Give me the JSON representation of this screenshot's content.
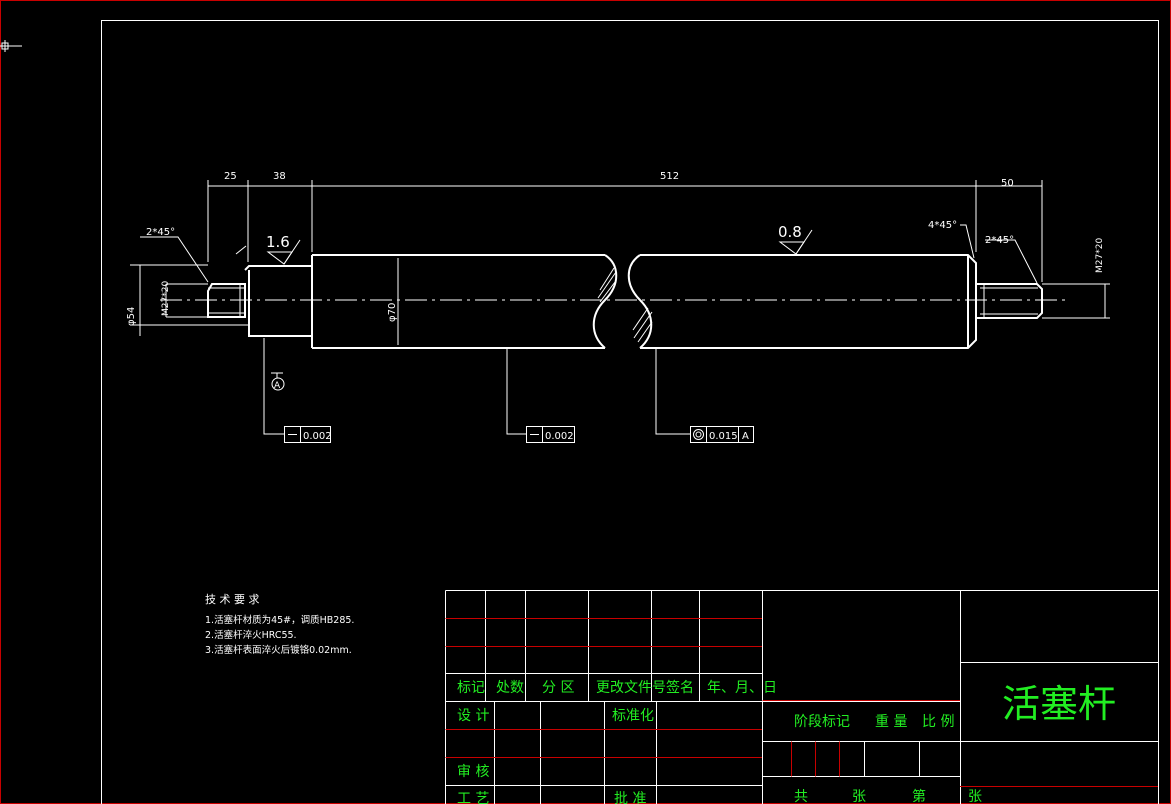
{
  "dimensions": {
    "d25": "25",
    "d38": "38",
    "d512": "512",
    "d50": "50",
    "chamfer_left": "2*45°",
    "chamfer_right_inner": "4*45°",
    "chamfer_right": "2*45°",
    "dia_left": "φ54",
    "thread_left": "M27*20",
    "dia_main": "φ70",
    "thread_right": "M27*20",
    "rough_left": "1.6",
    "rough_right": "0.8",
    "datum": "A",
    "tol_flat_1": "0.002",
    "tol_flat_2": "0.002",
    "tol_coax": "0.015",
    "tol_coax_datum": "A"
  },
  "tech_requirements": {
    "heading": "技 术 要 求",
    "items": [
      "1.活塞杆材质为45#，调质HB285.",
      "2.活塞杆淬火HRC55.",
      "3.活塞杆表面淬火后镀铬0.02mm."
    ]
  },
  "title_block": {
    "row_labels": [
      "标记",
      "处数",
      "分 区",
      "更改文件号",
      "签名",
      "年、月、日"
    ],
    "design": "设 计",
    "standardize": "标准化",
    "review": "审 核",
    "process": "工 艺",
    "approve": "批 准",
    "stage_mark": "阶段标记",
    "weight": "重 量",
    "scale": "比 例",
    "total": "共",
    "sheets1": "张",
    "page": "第",
    "sheets2": "张",
    "drawing_name": "活塞杆"
  },
  "colors": {
    "background": "#000000",
    "lines": "#ffffff",
    "text_green": "#22ee22",
    "grid_red": "#c80000"
  }
}
